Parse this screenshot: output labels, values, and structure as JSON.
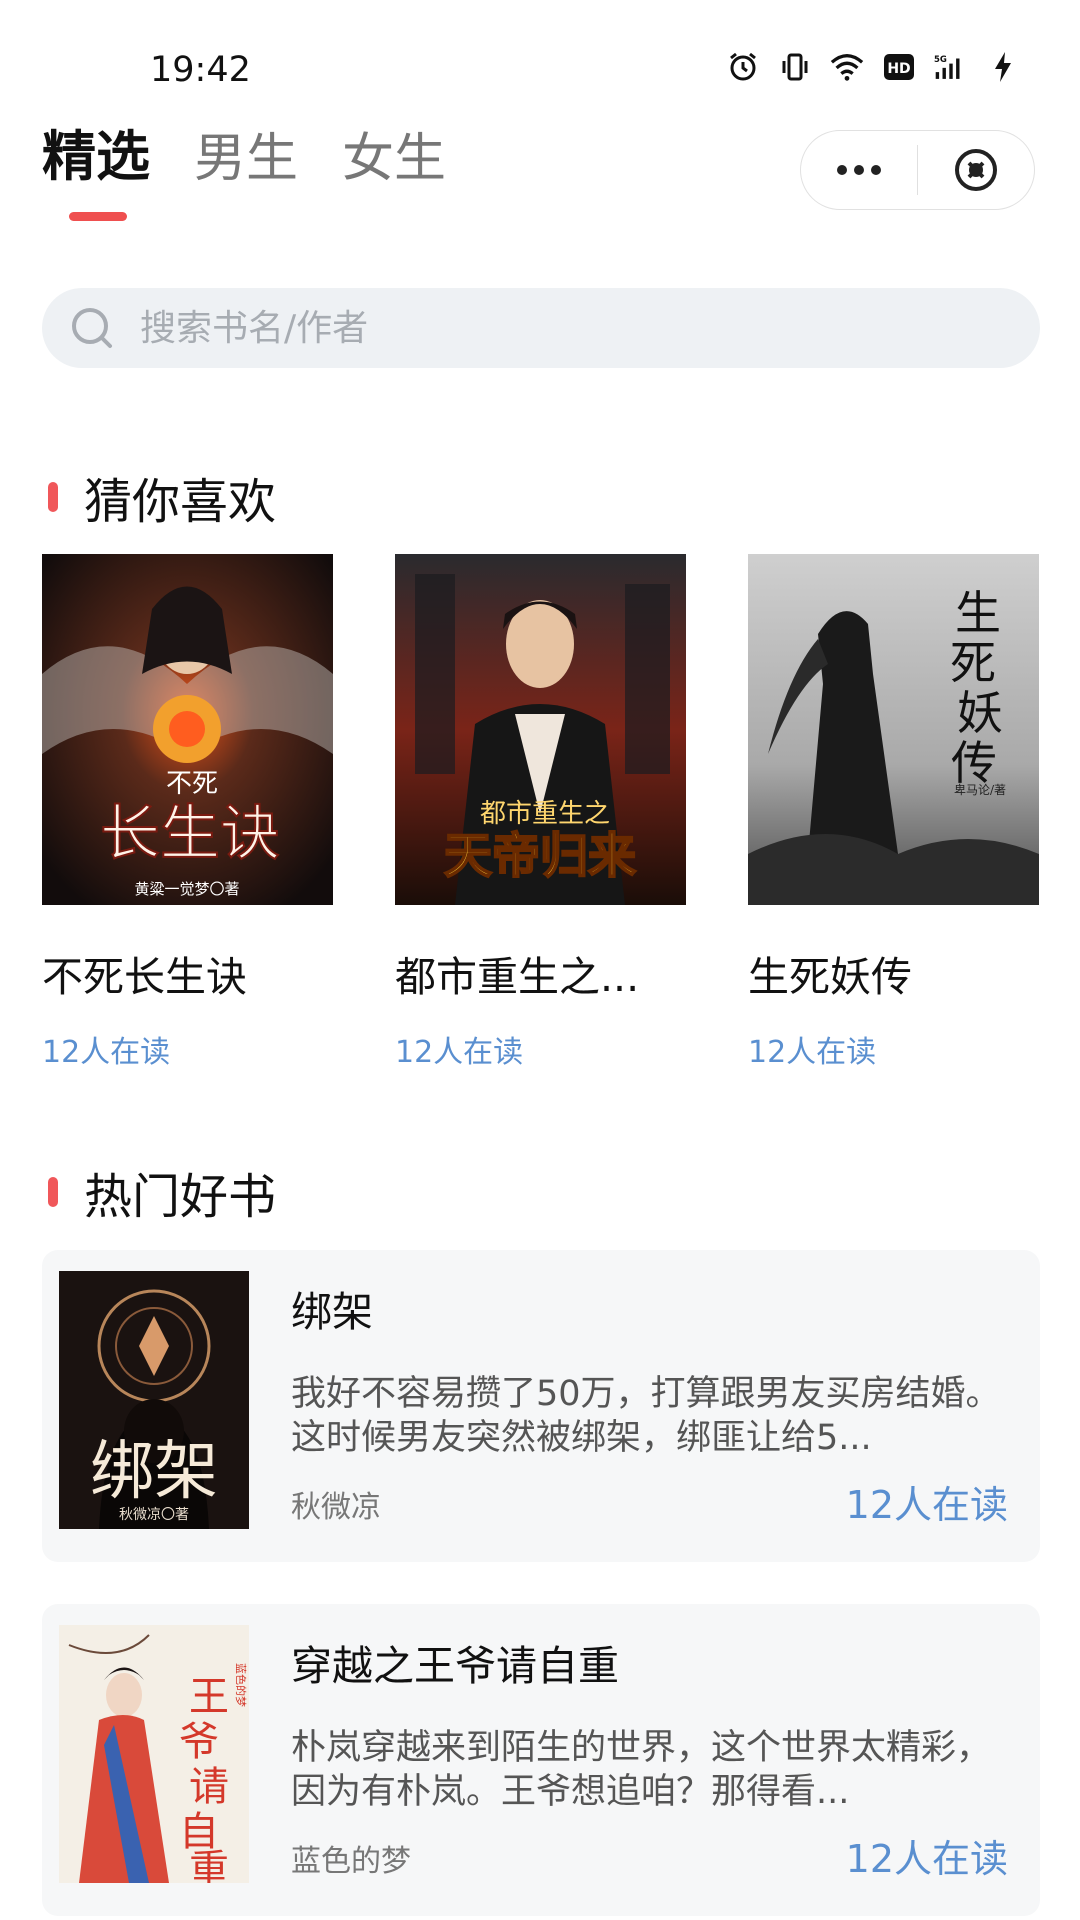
{
  "status_bar": {
    "time": "19:42",
    "icons": [
      "alarm-icon",
      "vibrate-icon",
      "wifi-icon",
      "hd-icon",
      "signal-5g-icon",
      "charging-icon"
    ]
  },
  "tabs": [
    {
      "label": "精选",
      "active": true
    },
    {
      "label": "男生",
      "active": false
    },
    {
      "label": "女生",
      "active": false
    }
  ],
  "capsule": {
    "icons": [
      "more-icon",
      "close-icon"
    ]
  },
  "search": {
    "placeholder": "搜索书名/作者"
  },
  "sections": {
    "recommend": {
      "title": "猜你喜欢"
    },
    "hot": {
      "title": "热门好书"
    }
  },
  "recommend_books": [
    {
      "title": "不死长生诀",
      "readers": "12人在读",
      "cover_text": "长生诀",
      "cover_badge": "不死",
      "cover_author": "黄粱一觉梦〇著"
    },
    {
      "title": "都市重生之...",
      "readers": "12人在读",
      "cover_text": "天帝归来",
      "cover_badge": "都市重生之",
      "cover_author": ""
    },
    {
      "title": "生死妖传",
      "readers": "12人在读",
      "cover_text": "生死妖传",
      "cover_author": "卑马论/著"
    }
  ],
  "hot_books": [
    {
      "title": "绑架",
      "description": "我好不容易攒了50万，打算跟男友买房结婚。这时候男友突然被绑架，绑匪让给5...",
      "author": "秋微凉",
      "readers": "12人在读",
      "cover_text": "绑架",
      "cover_author": "秋微凉〇著"
    },
    {
      "title": "穿越之王爷请自重",
      "description": "朴岚穿越来到陌生的世界，这个世界太精彩，因为有朴岚。王爷想追咱？那得看...",
      "author": "蓝色的梦",
      "readers": "12人在读",
      "cover_text": "王爷请自重",
      "cover_author": "蓝色的梦"
    }
  ],
  "colors": {
    "accent": "#ef4f4f",
    "readers": "#5a8fd0",
    "search_bg": "#eef1f4",
    "card_bg": "#f6f7f8"
  }
}
